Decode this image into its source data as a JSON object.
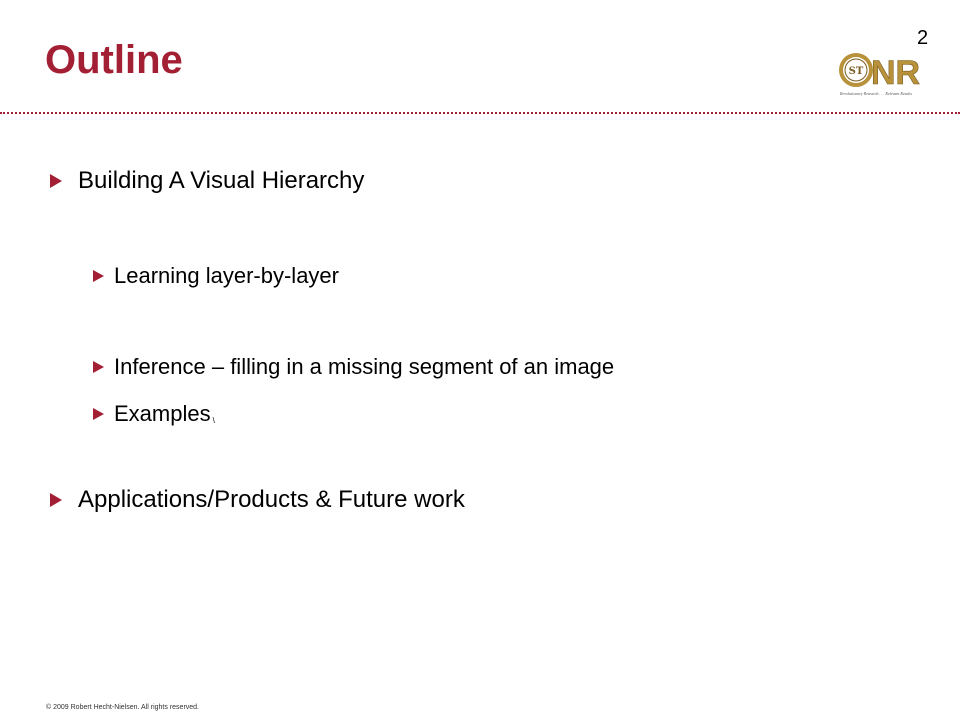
{
  "slide": {
    "title": "Outline",
    "page_number": "2"
  },
  "logo": {
    "letters": "NR",
    "seal_text": "ST",
    "tagline": "Revolutionary Research . . . Relevant Results"
  },
  "bullets": {
    "item1": "Building A Visual Hierarchy",
    "item1_sub1": "Learning layer-by-layer",
    "item1_sub2": "Inference – filling in a missing segment of an image",
    "item1_sub3": "Examples",
    "item1_sub3_suffix": "\\",
    "item2": "Applications/Products & Future work"
  },
  "footer": {
    "copyright": "© 2009 Robert  Hecht-Nielsen.  All rights reserved."
  },
  "colors": {
    "accent": "#a31f34",
    "logo_gold": "#b8923a",
    "logo_brown": "#7a5a1e"
  }
}
